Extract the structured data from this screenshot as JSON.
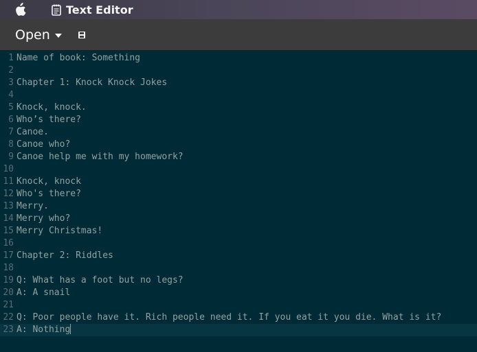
{
  "app": {
    "title": "Text Editor",
    "logo_icon": "apple-logo-icon",
    "app_icon": "notepad-icon"
  },
  "toolbar": {
    "open_label": "Open",
    "open_menu_icon": "chevron-down-icon",
    "save_icon": "save-icon"
  },
  "editor": {
    "cursor_line": 23,
    "lines": [
      {
        "number": "1",
        "text": "Name of book: Something"
      },
      {
        "number": "2",
        "text": ""
      },
      {
        "number": "3",
        "text": "Chapter 1: Knock Knock Jokes"
      },
      {
        "number": "4",
        "text": ""
      },
      {
        "number": "5",
        "text": "Knock, knock."
      },
      {
        "number": "6",
        "text": "Who’s there?"
      },
      {
        "number": "7",
        "text": "Canoe."
      },
      {
        "number": "8",
        "text": "Canoe who?"
      },
      {
        "number": "9",
        "text": "Canoe help me with my homework?"
      },
      {
        "number": "10",
        "text": ""
      },
      {
        "number": "11",
        "text": "Knock, knock"
      },
      {
        "number": "12",
        "text": "Who's there?"
      },
      {
        "number": "13",
        "text": "Merry."
      },
      {
        "number": "14",
        "text": "Merry who?"
      },
      {
        "number": "15",
        "text": "Merry Christmas!"
      },
      {
        "number": "16",
        "text": ""
      },
      {
        "number": "17",
        "text": "Chapter 2: Riddles"
      },
      {
        "number": "18",
        "text": ""
      },
      {
        "number": "19",
        "text": "Q: What has a foot but no legs?"
      },
      {
        "number": "20",
        "text": "A: A snail"
      },
      {
        "number": "21",
        "text": ""
      },
      {
        "number": "22",
        "text": "Q: Poor people have it. Rich people need it. If you eat it you die. What is it?"
      },
      {
        "number": "23",
        "text": "A: Nothing"
      }
    ]
  },
  "colors": {
    "editor_background": "#002b36",
    "current_line": "#073642",
    "text": "#93a1a1",
    "line_number": "#586e75"
  }
}
